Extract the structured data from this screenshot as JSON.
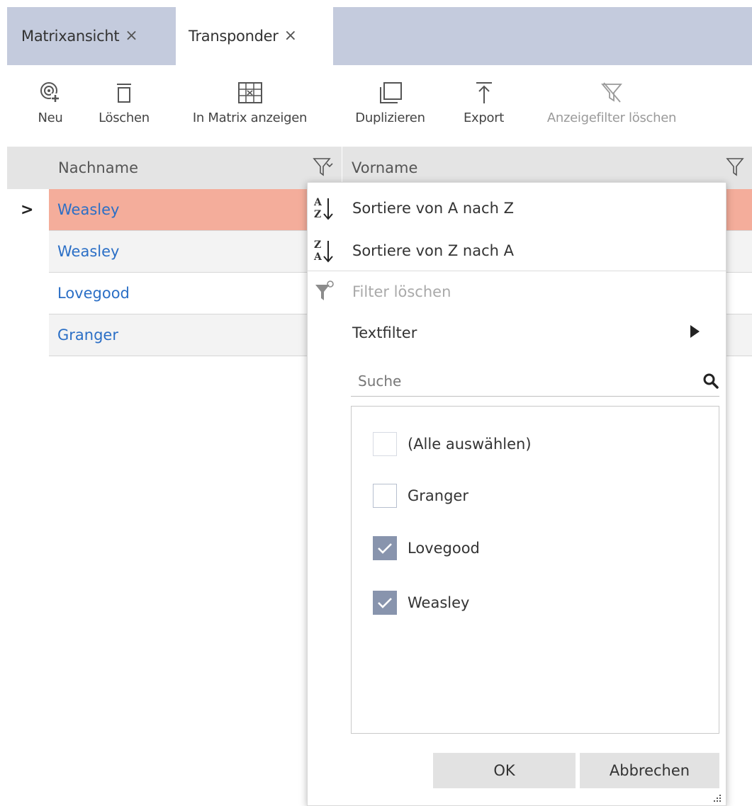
{
  "tabs": [
    {
      "label": "Matrixansicht",
      "close": "×"
    },
    {
      "label": "Transponder",
      "close": "×"
    }
  ],
  "toolbar": {
    "new_label": "Neu",
    "delete_label": "Löschen",
    "show_in_matrix_label": "In Matrix anzeigen",
    "duplicate_label": "Duplizieren",
    "export_label": "Export",
    "clear_filter_label": "Anzeigefilter löschen"
  },
  "grid": {
    "columns": [
      "Nachname",
      "Vorname"
    ],
    "rows": [
      "Weasley",
      "Weasley",
      "Lovegood",
      "Granger"
    ],
    "current_row_marker": ">"
  },
  "filter_popup": {
    "sort_asc": "Sortiere von A nach Z",
    "sort_desc": "Sortiere von Z nach A",
    "clear_filter": "Filter löschen",
    "text_filter": "Textfilter",
    "search_placeholder": "Suche",
    "items": [
      {
        "label": "(Alle auswählen)",
        "state": "indeterminate"
      },
      {
        "label": "Granger",
        "state": "unchecked"
      },
      {
        "label": "Lovegood",
        "state": "checked"
      },
      {
        "label": "Weasley",
        "state": "checked"
      }
    ],
    "ok_label": "OK",
    "cancel_label": "Abbrechen"
  },
  "colors": {
    "tab_bar": "#c4cbdd",
    "selected_row": "#f4ad9b",
    "link_text": "#2b6fc6",
    "checkbox_checked": "#8894ad"
  }
}
